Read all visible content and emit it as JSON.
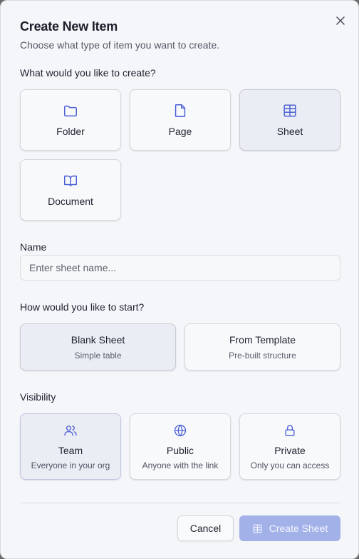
{
  "dialog": {
    "title": "Create New Item",
    "subtitle": "Choose what type of item you want to create."
  },
  "type_section": {
    "label": "What would you like to create?",
    "options": [
      {
        "label": "Folder",
        "icon": "folder-icon",
        "selected": false
      },
      {
        "label": "Page",
        "icon": "file-icon",
        "selected": false
      },
      {
        "label": "Sheet",
        "icon": "table-icon",
        "selected": true
      },
      {
        "label": "Document",
        "icon": "book-open-icon",
        "selected": false
      }
    ]
  },
  "name_section": {
    "label": "Name",
    "placeholder": "Enter sheet name...",
    "value": ""
  },
  "start_section": {
    "label": "How would you like to start?",
    "options": [
      {
        "title": "Blank Sheet",
        "description": "Simple table",
        "selected": true
      },
      {
        "title": "From Template",
        "description": "Pre-built structure",
        "selected": false
      }
    ]
  },
  "visibility_section": {
    "label": "Visibility",
    "options": [
      {
        "title": "Team",
        "description": "Everyone in your org",
        "icon": "users-icon",
        "selected": true
      },
      {
        "title": "Public",
        "description": "Anyone with the link",
        "icon": "globe-icon",
        "selected": false
      },
      {
        "title": "Private",
        "description": "Only you can access",
        "icon": "lock-icon",
        "selected": false
      }
    ]
  },
  "footer": {
    "cancel_label": "Cancel",
    "create_label": "Create Sheet",
    "create_icon": "table-icon"
  },
  "colors": {
    "accent": "#4b5fd6",
    "primary_button_disabled": "#a3b1e9",
    "selected_card": "#eaedf4"
  }
}
